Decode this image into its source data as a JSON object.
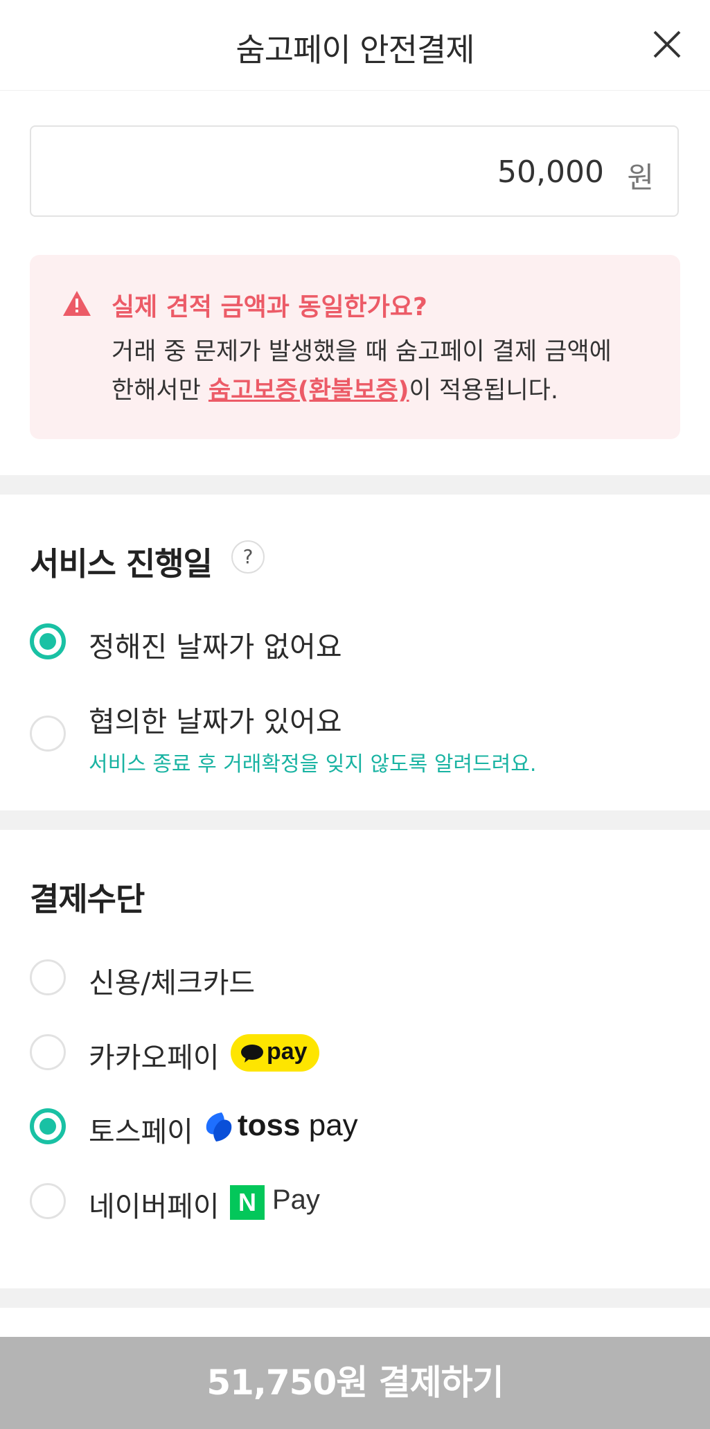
{
  "header": {
    "title": "숨고페이 안전결제",
    "close_icon": "close-icon"
  },
  "amount": {
    "value": "50,000",
    "unit": "원"
  },
  "warning": {
    "icon": "warning-triangle-icon",
    "title": "실제 견적 금액과 동일한가요?",
    "body_line1": "거래 중 문제가 발생했을 때 숨고페이 결제 금액에",
    "body_prefix": "한해서만 ",
    "link": "숨고보증(환불보증)",
    "body_suffix": "이 적용됩니다.",
    "accent_color": "#ec5b67",
    "background_color": "#fdf0f1"
  },
  "service_date": {
    "title": "서비스 진행일",
    "help_label": "?",
    "options": [
      {
        "label": "정해진 날짜가 없어요",
        "selected": true
      },
      {
        "label": "협의한 날짜가 있어요",
        "selected": false,
        "sub": "서비스 종료 후 거래확정을 잊지 않도록 알려드려요."
      }
    ]
  },
  "payment": {
    "title": "결제수단",
    "options": [
      {
        "label": "신용/체크카드",
        "selected": false
      },
      {
        "label": "카카오페이",
        "selected": false,
        "badge": "pay"
      },
      {
        "label": "토스페이",
        "selected": true,
        "badge_bold": "toss",
        "badge_light": "pay"
      },
      {
        "label": "네이버페이",
        "selected": false,
        "badge_n": "N",
        "badge": "Pay"
      }
    ]
  },
  "cta": {
    "label": "51,750원 결제하기"
  },
  "colors": {
    "accent": "#19c1a4",
    "button_disabled": "#b4b4b4",
    "kakao_yellow": "#fee500",
    "naver_green": "#03c75a",
    "toss_blue": "#1e6fff"
  }
}
